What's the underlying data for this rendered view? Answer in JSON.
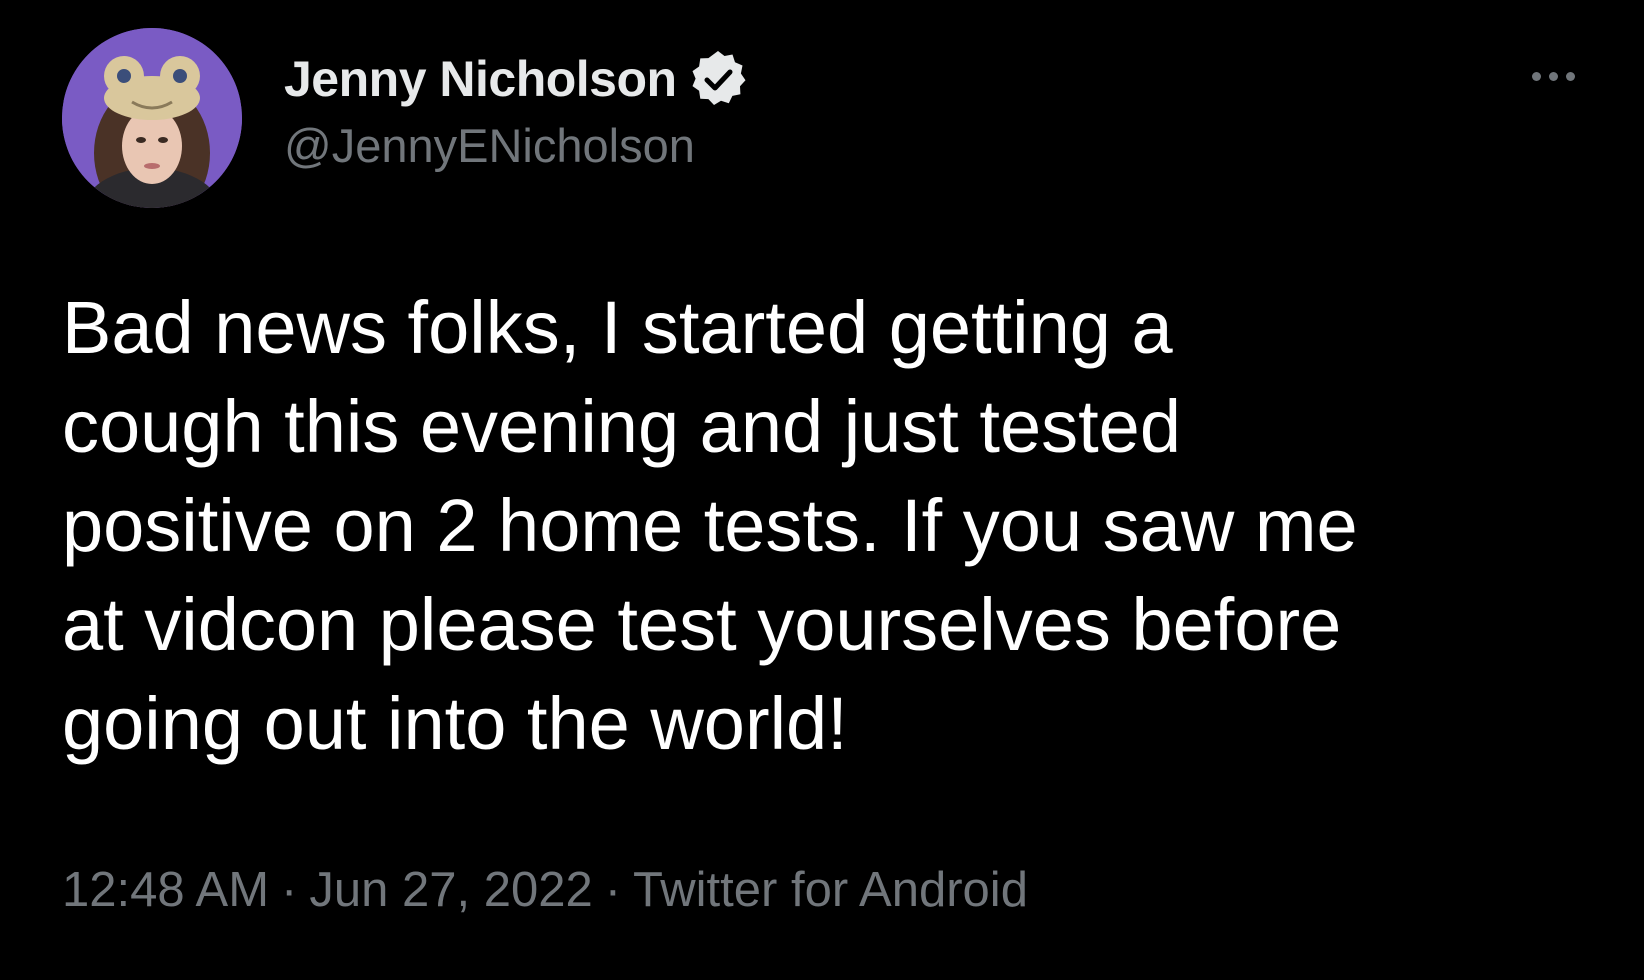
{
  "tweet": {
    "author": {
      "display_name": "Jenny Nicholson",
      "handle": "@JennyENicholson",
      "verified_icon": "verified-badge-icon",
      "avatar": "profile-avatar"
    },
    "more_icon": "more-options-icon",
    "text_lines": [
      "Bad news folks, I started getting a",
      "cough this evening and just tested",
      "positive on 2 home tests. If you saw me",
      "at vidcon please test yourselves before",
      "going out into the world!"
    ],
    "meta": {
      "time": "12:48 AM",
      "separator": "·",
      "date": "Jun 27, 2022",
      "source": "Twitter for Android"
    }
  },
  "colors": {
    "background": "#000000",
    "primary_text": "#e7e9ea",
    "secondary_text": "#71767b",
    "avatar_bg": "#7a5bc4"
  }
}
